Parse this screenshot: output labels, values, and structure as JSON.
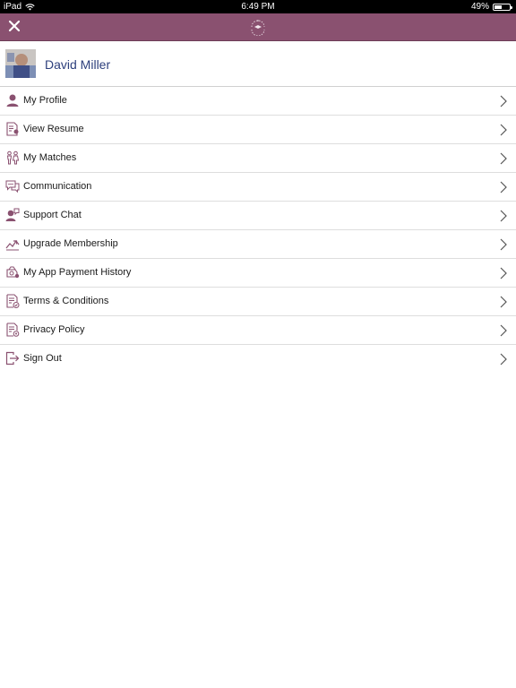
{
  "status_bar": {
    "device": "iPad",
    "time": "6:49 PM",
    "battery_text": "49%",
    "battery_level": 0.49
  },
  "nav": {
    "close_icon": "close-icon",
    "logo_icon": "brand-logo-icon",
    "brand_color": "#8a5170"
  },
  "profile": {
    "name": "David Miller",
    "name_color": "#2d3f7c"
  },
  "menu": [
    {
      "label": "My Profile",
      "icon": "user-icon"
    },
    {
      "label": "View Resume",
      "icon": "resume-icon"
    },
    {
      "label": "My Matches",
      "icon": "matches-icon"
    },
    {
      "label": "Communication",
      "icon": "chat-bubbles-icon"
    },
    {
      "label": "Support Chat",
      "icon": "support-chat-icon"
    },
    {
      "label": "Upgrade Membership",
      "icon": "upgrade-icon"
    },
    {
      "label": "My App Payment History",
      "icon": "payment-history-icon"
    },
    {
      "label": "Terms & Conditions",
      "icon": "terms-icon"
    },
    {
      "label": "Privacy Policy",
      "icon": "privacy-icon"
    },
    {
      "label": "Sign Out",
      "icon": "sign-out-icon"
    }
  ],
  "icon_color": "#8a5170"
}
